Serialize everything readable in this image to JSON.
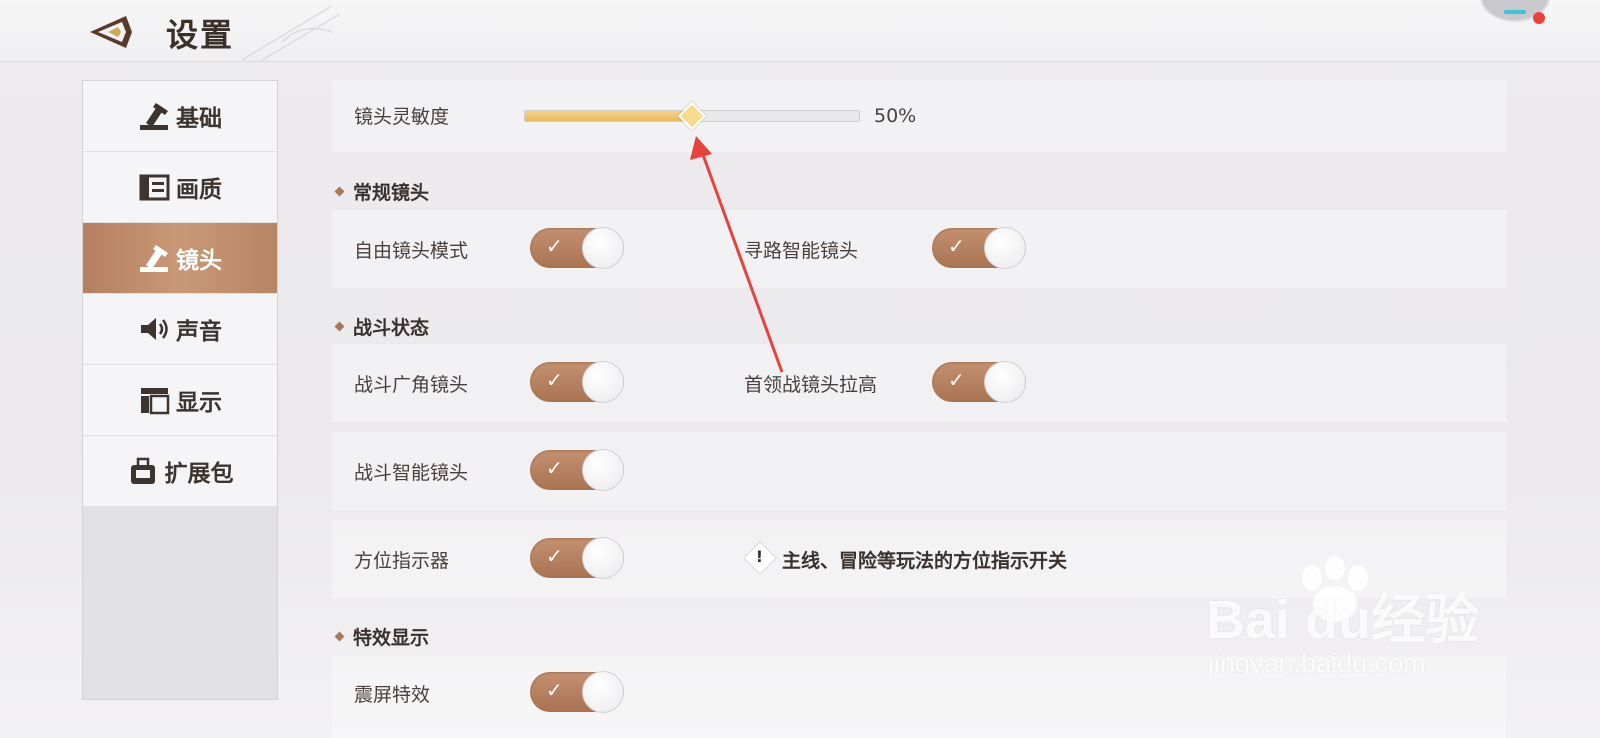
{
  "header": {
    "title": "设置"
  },
  "sidebar": {
    "items": [
      {
        "label": "基础",
        "icon": "hammer-icon",
        "active": false
      },
      {
        "label": "画质",
        "icon": "picture-icon",
        "active": false
      },
      {
        "label": "镜头",
        "icon": "hammer-icon",
        "active": true
      },
      {
        "label": "声音",
        "icon": "speaker-icon",
        "active": false
      },
      {
        "label": "显示",
        "icon": "layout-icon",
        "active": false
      },
      {
        "label": "扩展包",
        "icon": "bag-icon",
        "active": false
      }
    ]
  },
  "sensitivity": {
    "label": "镜头灵敏度",
    "value": 0.5,
    "value_text": "50%"
  },
  "sections": {
    "normal": {
      "title": "常规镜头",
      "free_camera": {
        "label": "自由镜头模式",
        "on": true
      },
      "pathfinding_camera": {
        "label": "寻路智能镜头",
        "on": true
      }
    },
    "combat": {
      "title": "战斗状态",
      "wide_angle": {
        "label": "战斗广角镜头",
        "on": true
      },
      "boss_raise": {
        "label": "首领战镜头拉高",
        "on": true
      },
      "smart_camera": {
        "label": "战斗智能镜头",
        "on": true
      },
      "direction_indicator": {
        "label": "方位指示器",
        "on": true,
        "hint": "主线、冒险等玩法的方位指示开关"
      }
    },
    "effects": {
      "title": "特效显示",
      "screen_shake": {
        "label": "震屏特效",
        "on": true
      }
    }
  },
  "toggle_check": "✓",
  "hint_mark": "!",
  "watermark": {
    "logo": "Bai du经验",
    "url": "jingyan.baidu.com"
  },
  "colors": {
    "accent": "#b88564",
    "slider_fill": "#eab65b",
    "annotation": "#e8423c"
  }
}
